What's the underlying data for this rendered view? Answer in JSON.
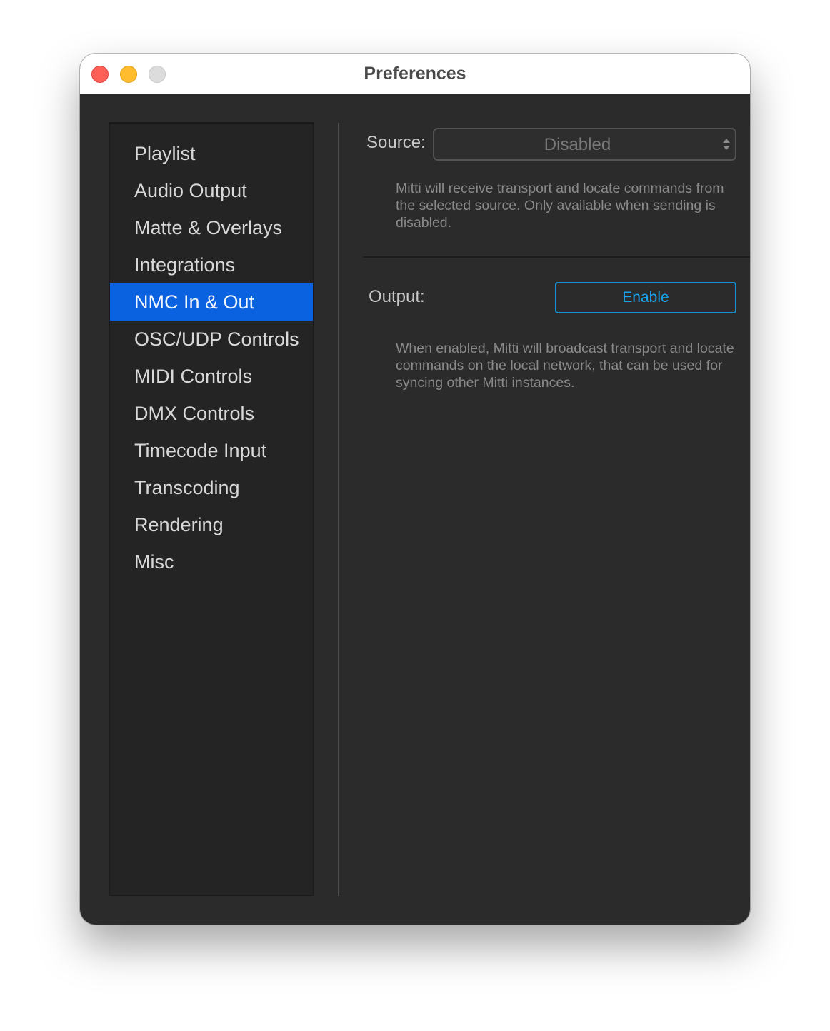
{
  "window": {
    "title": "Preferences"
  },
  "sidebar": {
    "items": [
      {
        "label": "Playlist",
        "selected": false
      },
      {
        "label": "Audio Output",
        "selected": false
      },
      {
        "label": "Matte & Overlays",
        "selected": false
      },
      {
        "label": "Integrations",
        "selected": false
      },
      {
        "label": "NMC In & Out",
        "selected": true
      },
      {
        "label": "OSC/UDP Controls",
        "selected": false
      },
      {
        "label": "MIDI Controls",
        "selected": false
      },
      {
        "label": "DMX Controls",
        "selected": false
      },
      {
        "label": "Timecode Input",
        "selected": false
      },
      {
        "label": "Transcoding",
        "selected": false
      },
      {
        "label": "Rendering",
        "selected": false
      },
      {
        "label": "Misc",
        "selected": false
      }
    ],
    "selected_color": "#0a62e0"
  },
  "input": {
    "label": "Source:",
    "value": "Disabled",
    "description": "Mitti will receive transport and locate commands from the selected source. Only available when sending is disabled."
  },
  "output": {
    "label": "Output:",
    "button_label": "Enable",
    "description": "When enabled, Mitti will broadcast transport and locate commands on the local network, that can be used for syncing other Mitti instances.",
    "accent_color": "#1aa3ea"
  }
}
